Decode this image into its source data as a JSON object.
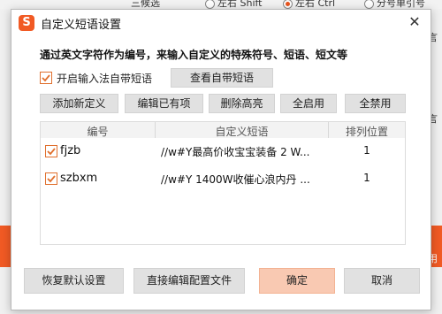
{
  "background": {
    "fragment_1": "三候选",
    "fragment_2": "左右 Shift",
    "fragment_3": "左右 Ctrl",
    "fragment_4": "分号单引号",
    "right_fragment_1": "言",
    "right_fragment_2": "言",
    "right_fragment_3": "用"
  },
  "dialog": {
    "title": "自定义短语设置",
    "logo_char": "S",
    "close_symbol": "✕",
    "description": "通过英文字符作为编号，来输入自定义的特殊符号、短语、短文等",
    "enable_builtin_label": "开启输入法自带短语",
    "enable_builtin_checked": true,
    "view_builtin_button": "查看自带短语",
    "toolbar": {
      "add": "添加新定义",
      "edit": "编辑已有项",
      "delete": "删除高亮",
      "enable_all": "全启用",
      "disable_all": "全禁用"
    },
    "table": {
      "columns": [
        "编号",
        "自定义短语",
        "排列位置"
      ],
      "rows": [
        {
          "checked": true,
          "code": "fjzb",
          "phrase": "//w#Y最高价收宝宝装备   2 W...",
          "position": "1"
        },
        {
          "checked": true,
          "code": "szbxm",
          "phrase": "//w#Y 1400W收催心浪内丹  ...",
          "position": "1"
        }
      ]
    },
    "footer": {
      "restore": "恢复默认设置",
      "edit_config": "直接编辑配置文件",
      "ok": "确定",
      "cancel": "取消"
    },
    "colors": {
      "accent": "#f15a24",
      "primary_button": "#f9c9b2"
    }
  }
}
